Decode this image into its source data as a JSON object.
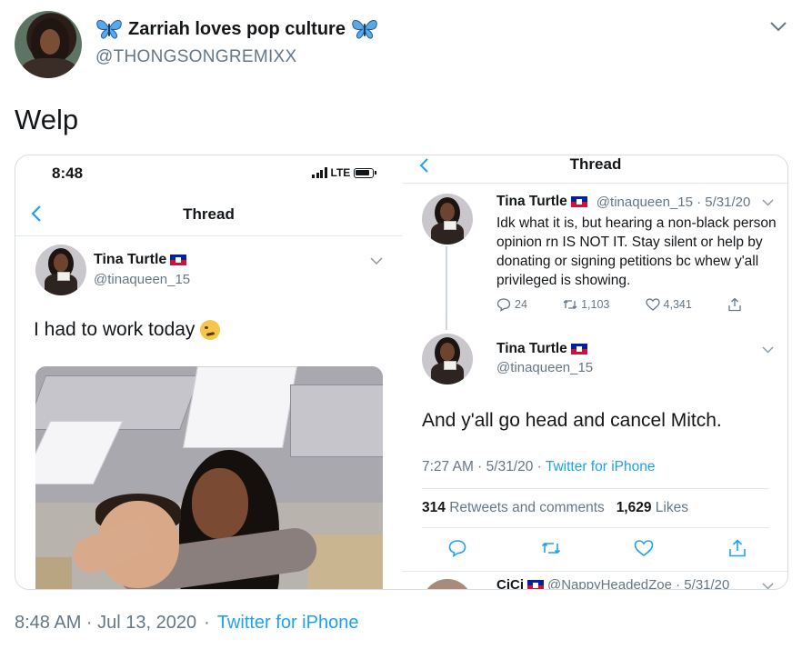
{
  "author": {
    "display_name": "Zarriah loves pop culture",
    "handle": "@THONGSONGREMIXX"
  },
  "tweet": {
    "text": "Welp",
    "timestamp": "8:48 AM · Jul 13, 2020",
    "separator": "·",
    "source": "Twitter for iPhone"
  },
  "left_screenshot": {
    "status_time": "8:48",
    "carrier": "LTE",
    "nav_title": "Thread",
    "tweet": {
      "name": "Tina Turtle",
      "handle": "@tinaqueen_15",
      "text": "I had to work today"
    }
  },
  "right_screenshot": {
    "nav_title": "Thread",
    "parent_tweet": {
      "name": "Tina Turtle",
      "meta": "@tinaqueen_15 · 5/31/20",
      "text": "Idk what it is, but hearing a non-black person opinion rn IS NOT IT. Stay silent or help by donating or signing petitions bc whew y'all privileged is showing.",
      "replies": "24",
      "retweets": "1,103",
      "likes": "4,341"
    },
    "main_tweet": {
      "name": "Tina Turtle",
      "handle": "@tinaqueen_15",
      "text": "And y'all go head and cancel Mitch.",
      "time": "7:27 AM · 5/31/20 ·",
      "source": "Twitter for iPhone",
      "retweet_count": "314",
      "retweet_label": "Retweets and comments",
      "like_count": "1,629",
      "like_label": "Likes"
    },
    "next_reply": {
      "name": "CiCi",
      "meta": "@NappyHeadedZoe · 5/31/20"
    }
  },
  "colors": {
    "link": "#1da1f2",
    "muted": "#657786",
    "text": "#14171a"
  }
}
